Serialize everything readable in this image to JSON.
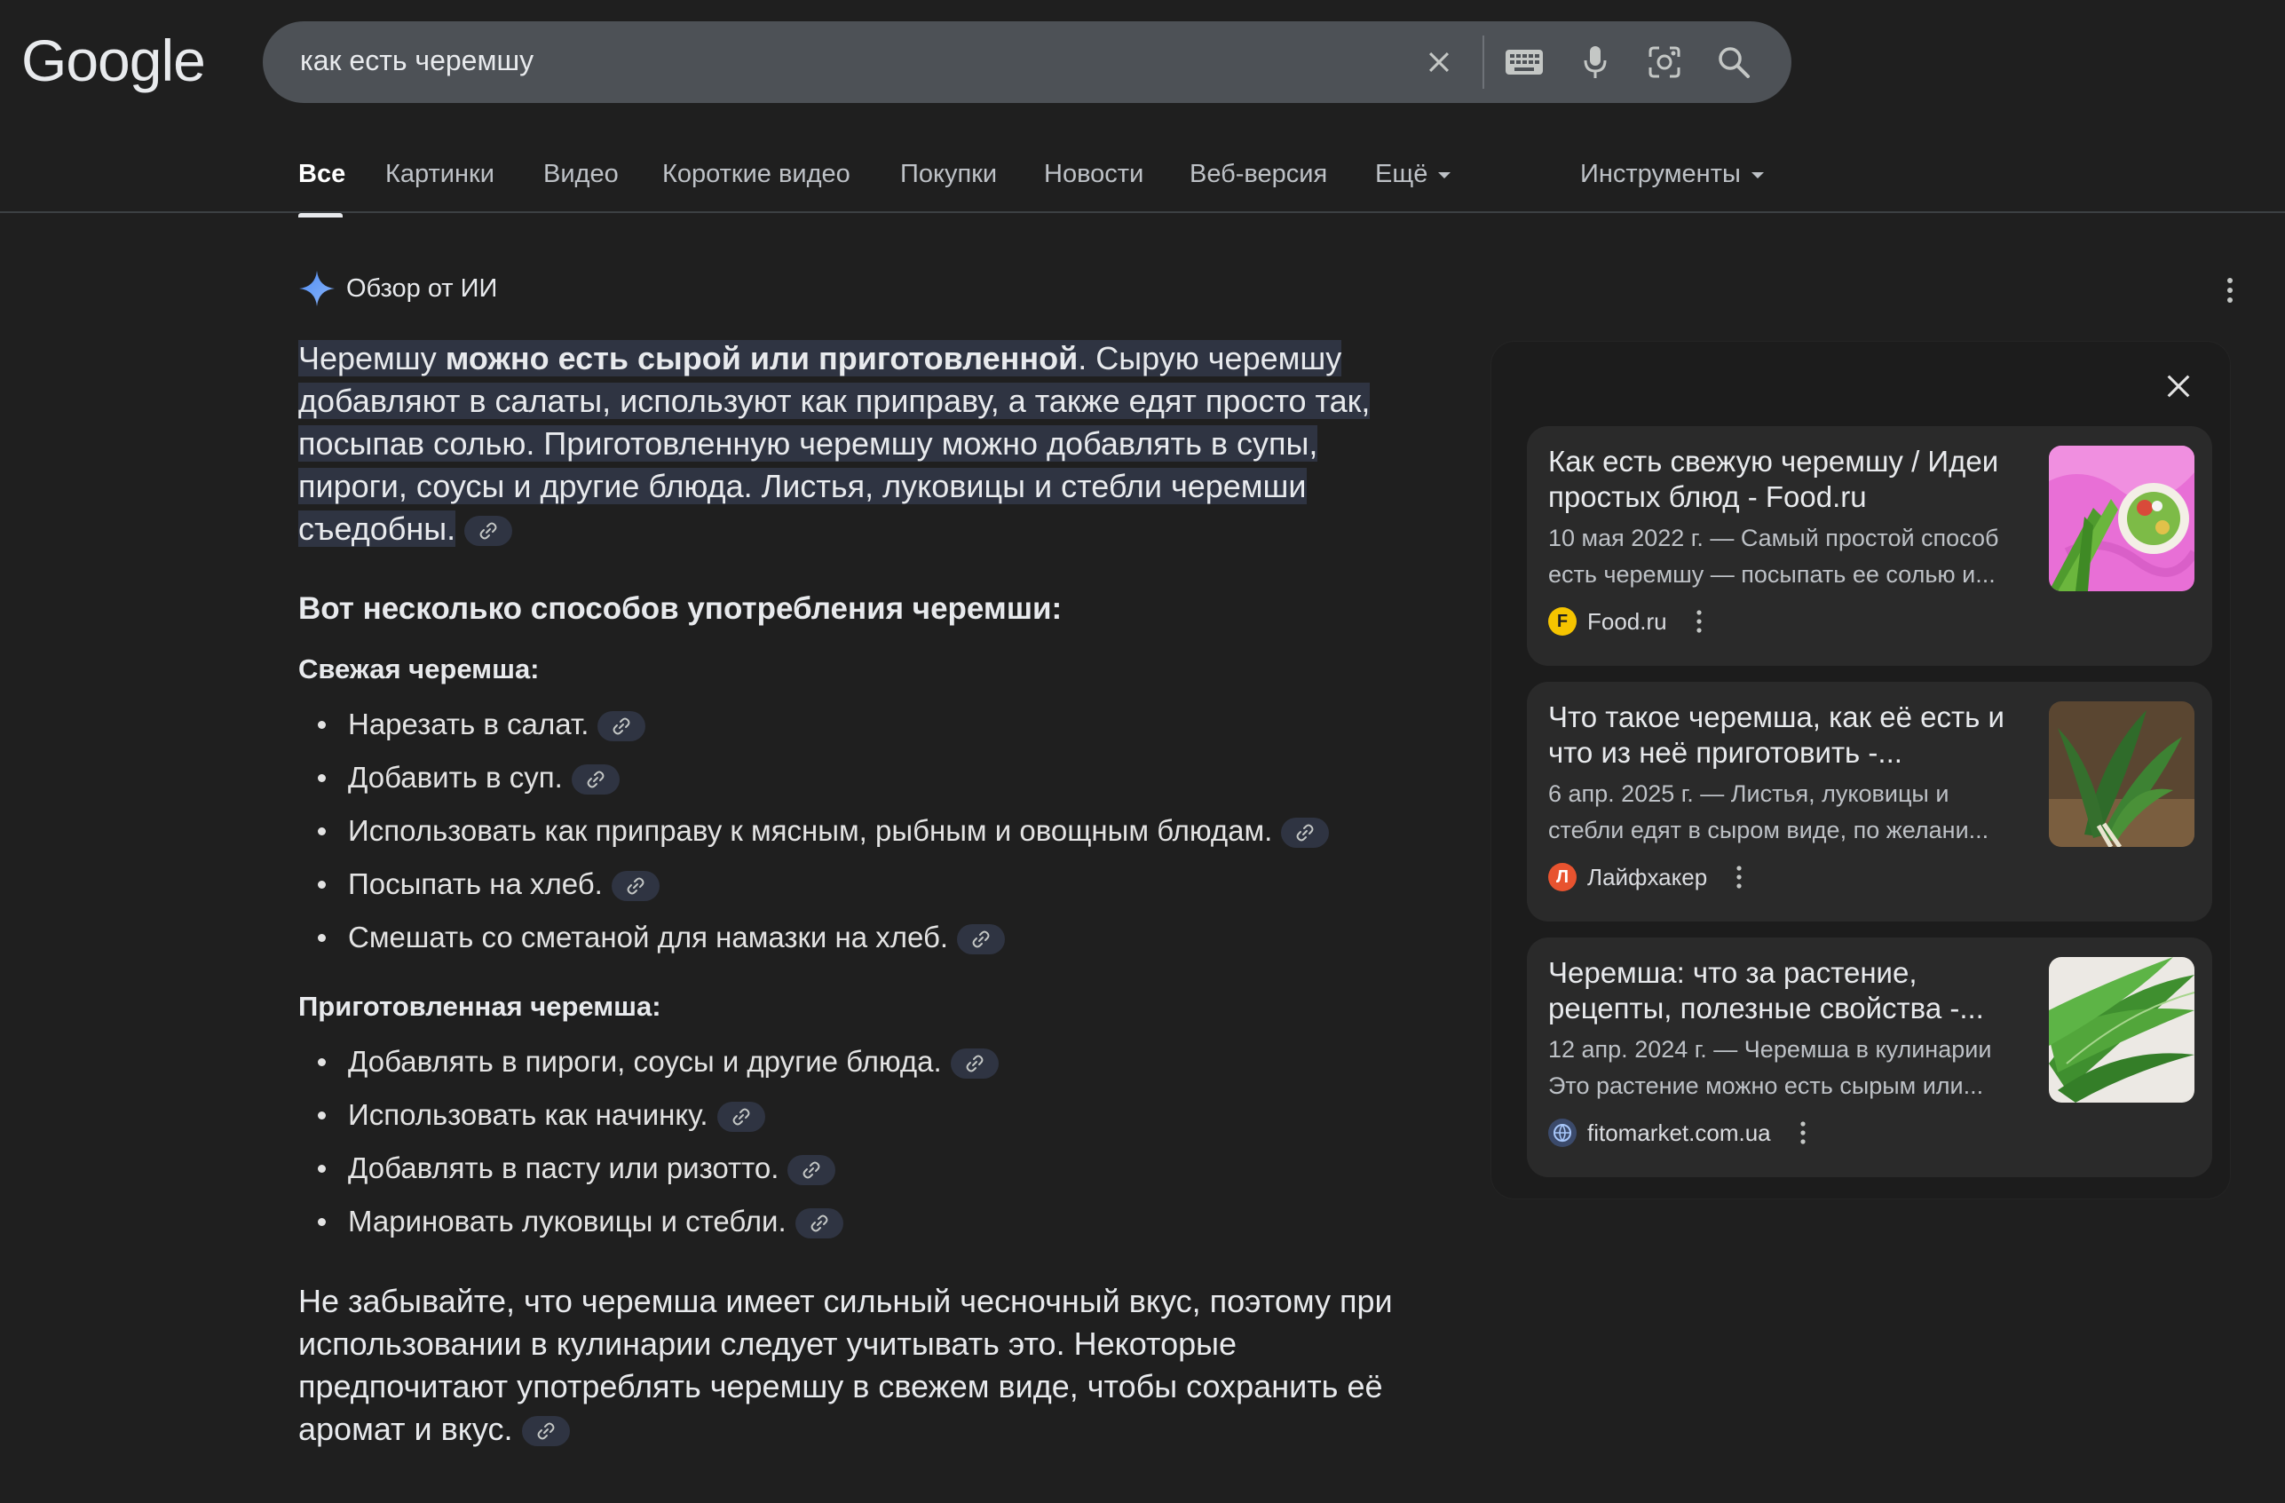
{
  "header": {
    "logo": "Google",
    "search_query": "как есть черемшу"
  },
  "tabs": [
    {
      "label": "Все",
      "active": true
    },
    {
      "label": "Картинки"
    },
    {
      "label": "Видео"
    },
    {
      "label": "Короткие видео"
    },
    {
      "label": "Покупки"
    },
    {
      "label": "Новости"
    },
    {
      "label": "Веб-версия"
    },
    {
      "label": "Ещё",
      "dropdown": true
    }
  ],
  "tools_label": "Инструменты",
  "ai_overview": {
    "label": "Обзор от ИИ",
    "lead_start": "Черемшу ",
    "lead_bold": "можно есть сырой или приготовленной",
    "lead_rest": ". Сырую черемшу добавляют в салаты, используют как приправу, а также едят просто так, посыпав солью. Приготовленную черемшу можно добавлять в супы, пироги, соусы и другие блюда. Листья, луковицы и стебли черемши съедобны.",
    "ways_heading": "Вот несколько способов употребления черемши:",
    "fresh_heading": "Свежая черемша:",
    "fresh_items": [
      "Нарезать в салат.",
      "Добавить в суп.",
      "Использовать как приправу к мясным, рыбным и овощным блюдам.",
      "Посыпать на хлеб.",
      "Смешать со сметаной для намазки на хлеб."
    ],
    "cooked_heading": "Приготовленная черемша:",
    "cooked_items": [
      "Добавлять в пироги, соусы и другие блюда.",
      "Использовать как начинку.",
      "Добавлять в пасту или ризотто.",
      "Мариновать луковицы и стебли."
    ],
    "outro": "Не забывайте, что черемша имеет сильный чесночный вкус, поэтому при использовании в кулинарии следует учитывать это. Некоторые предпочитают употреблять черемшу в свежем виде, чтобы сохранить её аромат и вкус."
  },
  "sources": [
    {
      "title": "Как есть свежую черемшу / Идеи простых блюд - Food.ru",
      "snippet": "10 мая 2022 г. — Самый простой способ есть черемшу — посыпать ее солью и...",
      "site": "Food.ru",
      "favicon_letter": "F",
      "favicon_color": "#f5c400"
    },
    {
      "title": "Что такое черемша, как её есть и что из неё приготовить -...",
      "snippet": "6 апр. 2025 г. — Листья, луковицы и стебли едят в сыром виде, по желани...",
      "site": "Лайфхакер",
      "favicon_letter": "Л",
      "favicon_color": "#e8532f"
    },
    {
      "title": "Черемша: что за растение, рецепты, полезные свойства -...",
      "snippet": "12 апр. 2024 г. — Черемша в кулинарии Это растение можно есть сырым или...",
      "site": "fitomarket.com.ua",
      "favicon_letter": "",
      "favicon_color": "#3b4a6b"
    }
  ]
}
